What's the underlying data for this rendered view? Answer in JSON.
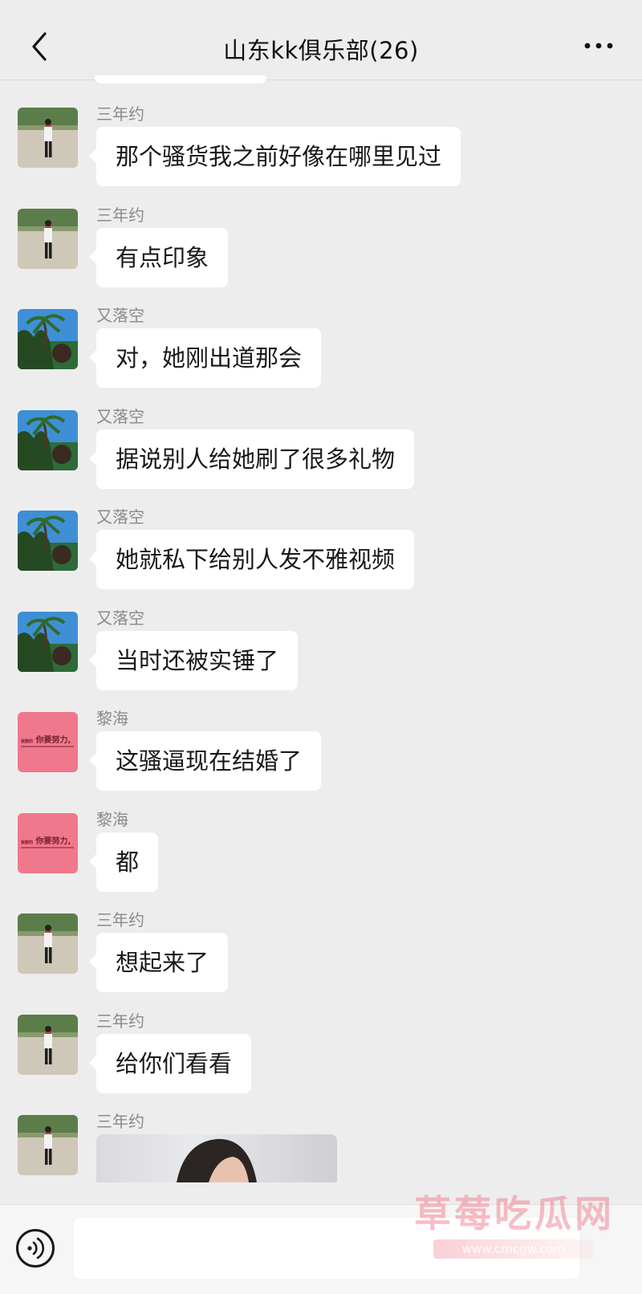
{
  "header": {
    "title": "山东kk俱乐部(26)"
  },
  "messages": [
    {
      "sender": "三年约",
      "text": "那个骚货我之前好像在哪里见过",
      "avatar": "person-outdoor-avatar"
    },
    {
      "sender": "三年约",
      "text": "有点印象",
      "avatar": "person-outdoor-avatar"
    },
    {
      "sender": "又落空",
      "text": "对，她刚出道那会",
      "avatar": "palm-tree-avatar"
    },
    {
      "sender": "又落空",
      "text": "据说别人给她刷了很多礼物",
      "avatar": "palm-tree-avatar"
    },
    {
      "sender": "又落空",
      "text": "她就私下给别人发不雅视频",
      "avatar": "palm-tree-avatar"
    },
    {
      "sender": "又落空",
      "text": "当时还被实锤了",
      "avatar": "palm-tree-avatar"
    },
    {
      "sender": "黎海",
      "text": "这骚逼现在结婚了",
      "avatar": "pink-text-avatar",
      "avatar_text": "你要努力,"
    },
    {
      "sender": "黎海",
      "text": "都",
      "avatar": "pink-text-avatar",
      "avatar_text": "你要努力,"
    },
    {
      "sender": "三年约",
      "text": "想起来了",
      "avatar": "person-outdoor-avatar"
    },
    {
      "sender": "三年约",
      "text": "给你们看看",
      "avatar": "person-outdoor-avatar"
    },
    {
      "sender": "三年约",
      "text": "",
      "avatar": "person-outdoor-avatar",
      "image": true
    }
  ],
  "composer": {
    "placeholder": ""
  },
  "watermark": {
    "title": "草莓吃瓜网",
    "url": "www.cmcgw.com"
  },
  "colors": {
    "background": "#ededed",
    "bubble": "#ffffff",
    "avatar_pink": "#f0788c"
  }
}
